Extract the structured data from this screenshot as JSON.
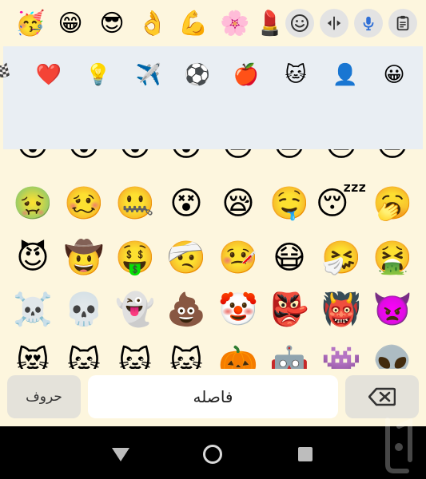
{
  "toolbar": {
    "recent_emojis": [
      "🥳",
      "😁",
      "😎",
      "👌",
      "💪",
      "🌸",
      "💄"
    ],
    "emoji_button_icon": "smiley-icon",
    "move_button_icon": "move-arrows-icon",
    "voice_button_icon": "microphone-icon",
    "clipboard_button_icon": "clipboard-icon"
  },
  "categories": [
    "🏁",
    "❤️",
    "💡",
    "✈️",
    "⚽",
    "🍎",
    "🐱",
    "👤",
    "😀"
  ],
  "grid": {
    "partial_row": [
      "😮",
      "😮",
      "😮",
      "😮",
      "😑",
      "😑",
      "😑",
      "😑"
    ],
    "rows": [
      [
        "🤢",
        "🥴",
        "🤐",
        "😵",
        "😪",
        "🤤",
        "😴",
        "🥱"
      ],
      [
        "😈",
        "🤠",
        "🤑",
        "🤕",
        "🤒",
        "😷",
        "🤧",
        "🤮"
      ],
      [
        "☠️",
        "💀",
        "👻",
        "💩",
        "🤡",
        "👺",
        "👹",
        "👿"
      ],
      [
        "😻",
        "🐱",
        "🐱",
        "🐱",
        "🎃",
        "🤖",
        "👾",
        "👽"
      ]
    ]
  },
  "bottom_bar": {
    "letters_label": "حروف",
    "space_label": "فاصله",
    "backspace_icon": "backspace-icon"
  },
  "navigation": {
    "back_icon": "back-triangle-icon",
    "home_icon": "home-circle-icon",
    "recents_icon": "recents-square-icon"
  },
  "colors": {
    "keyboard_background": "#fdf6de",
    "category_panel": "#e9eef3",
    "mic_accent": "#2f6fd6",
    "nav_bar": "#000000"
  }
}
